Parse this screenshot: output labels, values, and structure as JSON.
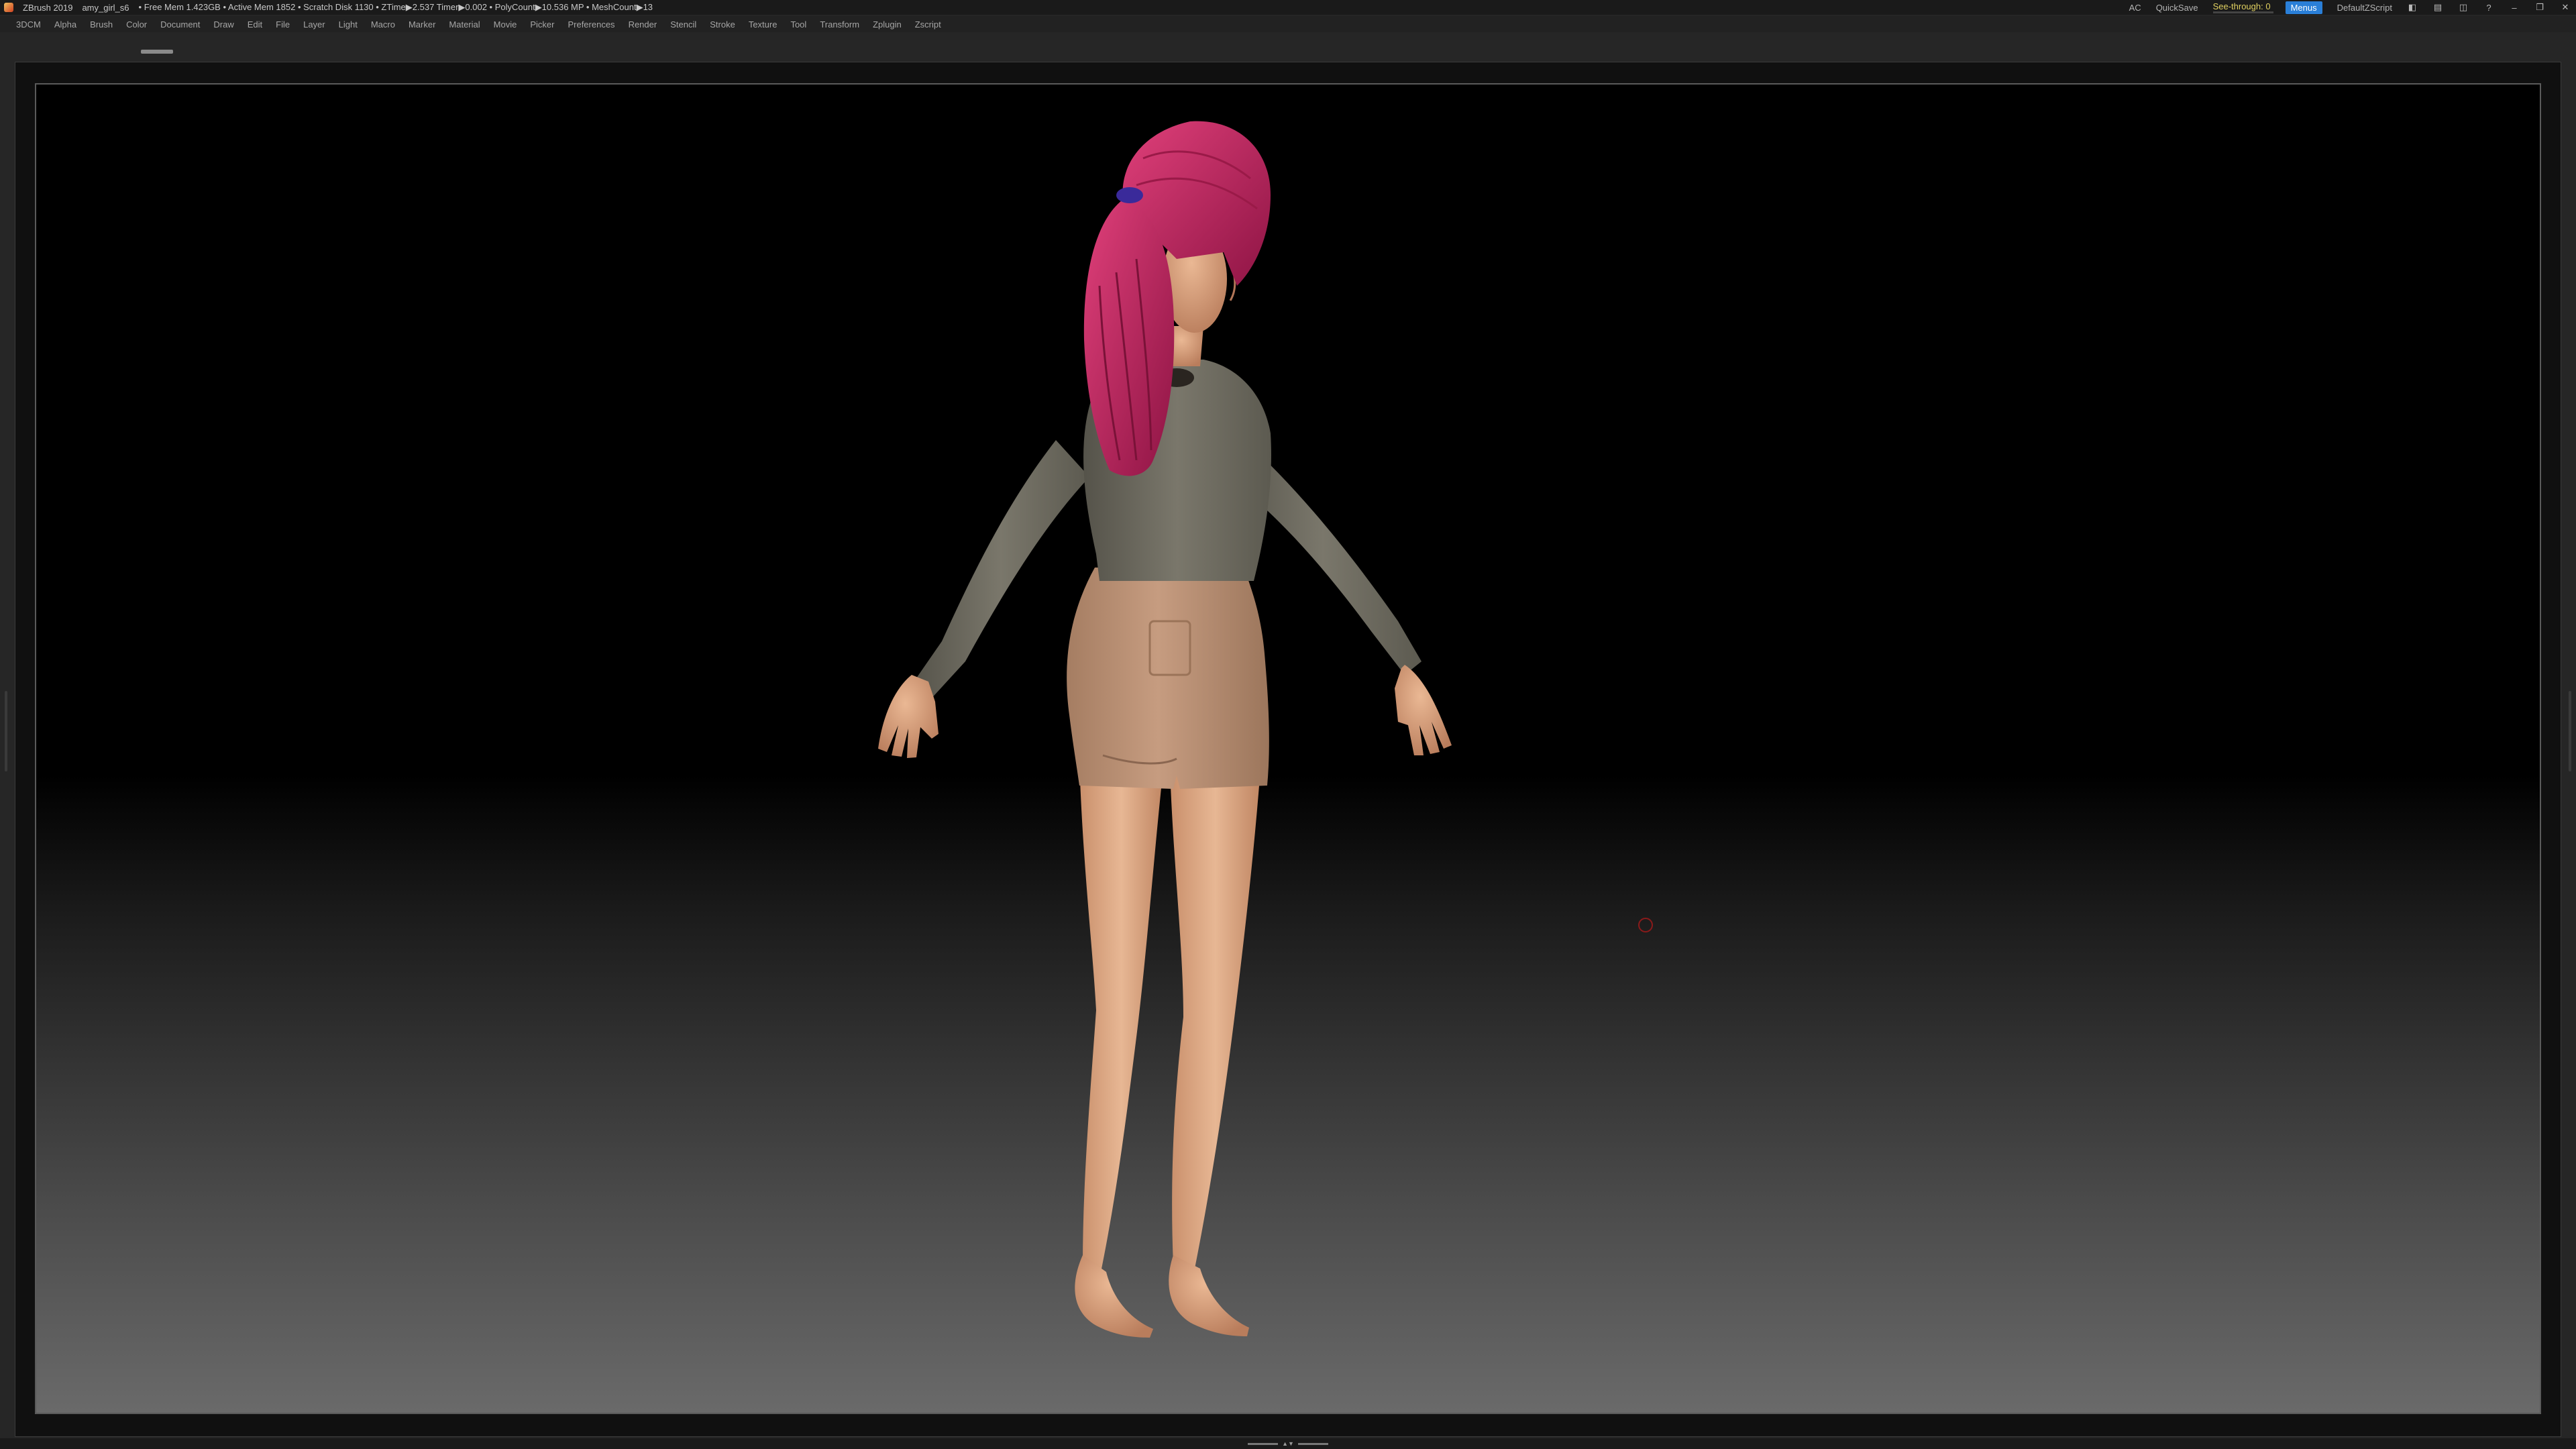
{
  "titlebar": {
    "app_name": "ZBrush 2019",
    "document_name": "amy_girl_s6",
    "stats": "• Free Mem 1.423GB • Active Mem 1852 • Scratch Disk 1130 • ZTime▶2.537 Timer▶0.002 • PolyCount▶10.536 MP • MeshCount▶13",
    "ac_label": "AC",
    "quicksave_label": "QuickSave",
    "see_through_label": "See-through",
    "see_through_value": "0",
    "see_through_level": 0,
    "menus_label": "Menus",
    "default_script_label": "DefaultZScript"
  },
  "menubar": {
    "items": [
      "3DCM",
      "Alpha",
      "Brush",
      "Color",
      "Document",
      "Draw",
      "Edit",
      "File",
      "Layer",
      "Light",
      "Macro",
      "Marker",
      "Material",
      "Movie",
      "Picker",
      "Preferences",
      "Render",
      "Stencil",
      "Stroke",
      "Texture",
      "Tool",
      "Transform",
      "Zplugin",
      "Zscript"
    ]
  },
  "colors": {
    "hair": "#c8225a",
    "skin": "#d9a07a",
    "shirt": "#6f6c60",
    "shorts": "#b88e72",
    "accent": "#2a7fd8"
  },
  "icons": {
    "app_logo": "zbrush-logo-icon",
    "cursor": "brush-cursor-icon"
  }
}
